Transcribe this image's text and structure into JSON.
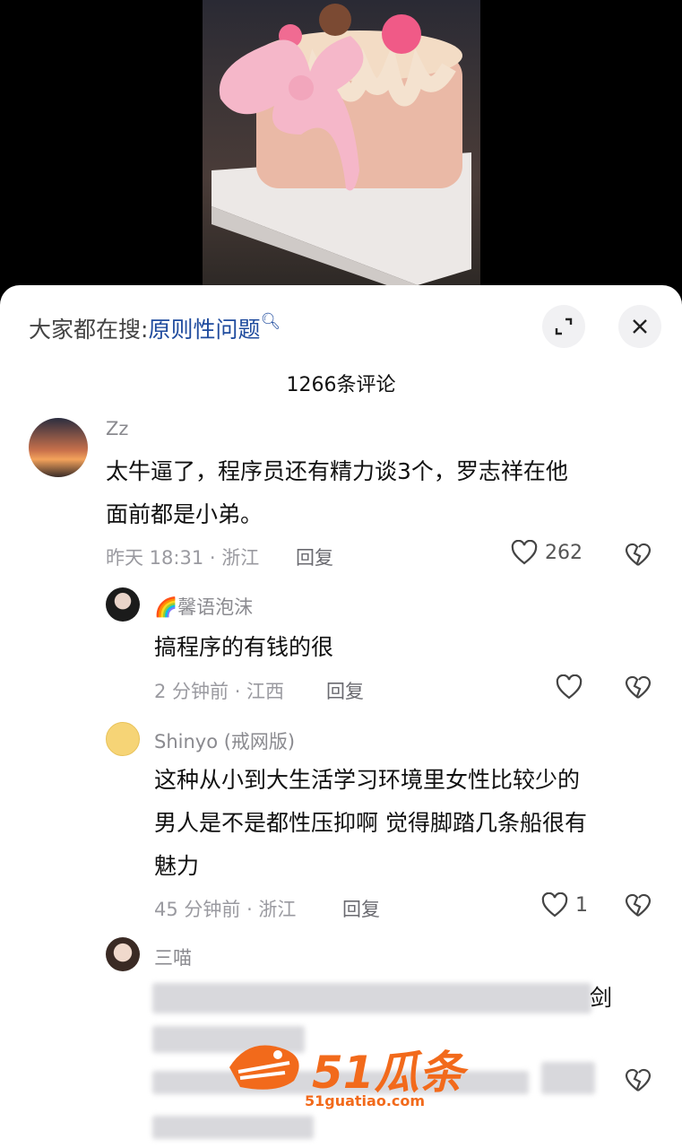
{
  "search": {
    "label": "大家都在搜:",
    "term": "原则性问题"
  },
  "comments_title": "1266条评论",
  "comments": [
    {
      "user": "Zz",
      "text_lines": [
        "太牛逼了，程序员还有精力谈3个，罗志祥在他",
        "面前都是小弟。"
      ],
      "meta": "昨天 18:31 · 浙江",
      "reply": "回复",
      "likes": "262"
    },
    {
      "user": "馨语泡沫",
      "user_prefix": "🌈",
      "text_lines": [
        "搞程序的有钱的很"
      ],
      "meta": "2 分钟前 · 江西",
      "reply": "回复",
      "likes": ""
    },
    {
      "user": "Shinyo (戒网版)",
      "text_lines": [
        "这种从小到大生活学习环境里女性比较少的",
        "男人是不是都性压抑啊 觉得脚踏几条船很有",
        "魅力"
      ],
      "meta": "45 分钟前 · 浙江",
      "reply": "回复",
      "likes": "1"
    },
    {
      "user": "三喵",
      "partial_text": "剑"
    }
  ],
  "watermark": {
    "brand": "51瓜条",
    "url": "51guatiao.com"
  },
  "colors": {
    "accent": "#1f4b9e",
    "watermark": "#f26a1b"
  }
}
